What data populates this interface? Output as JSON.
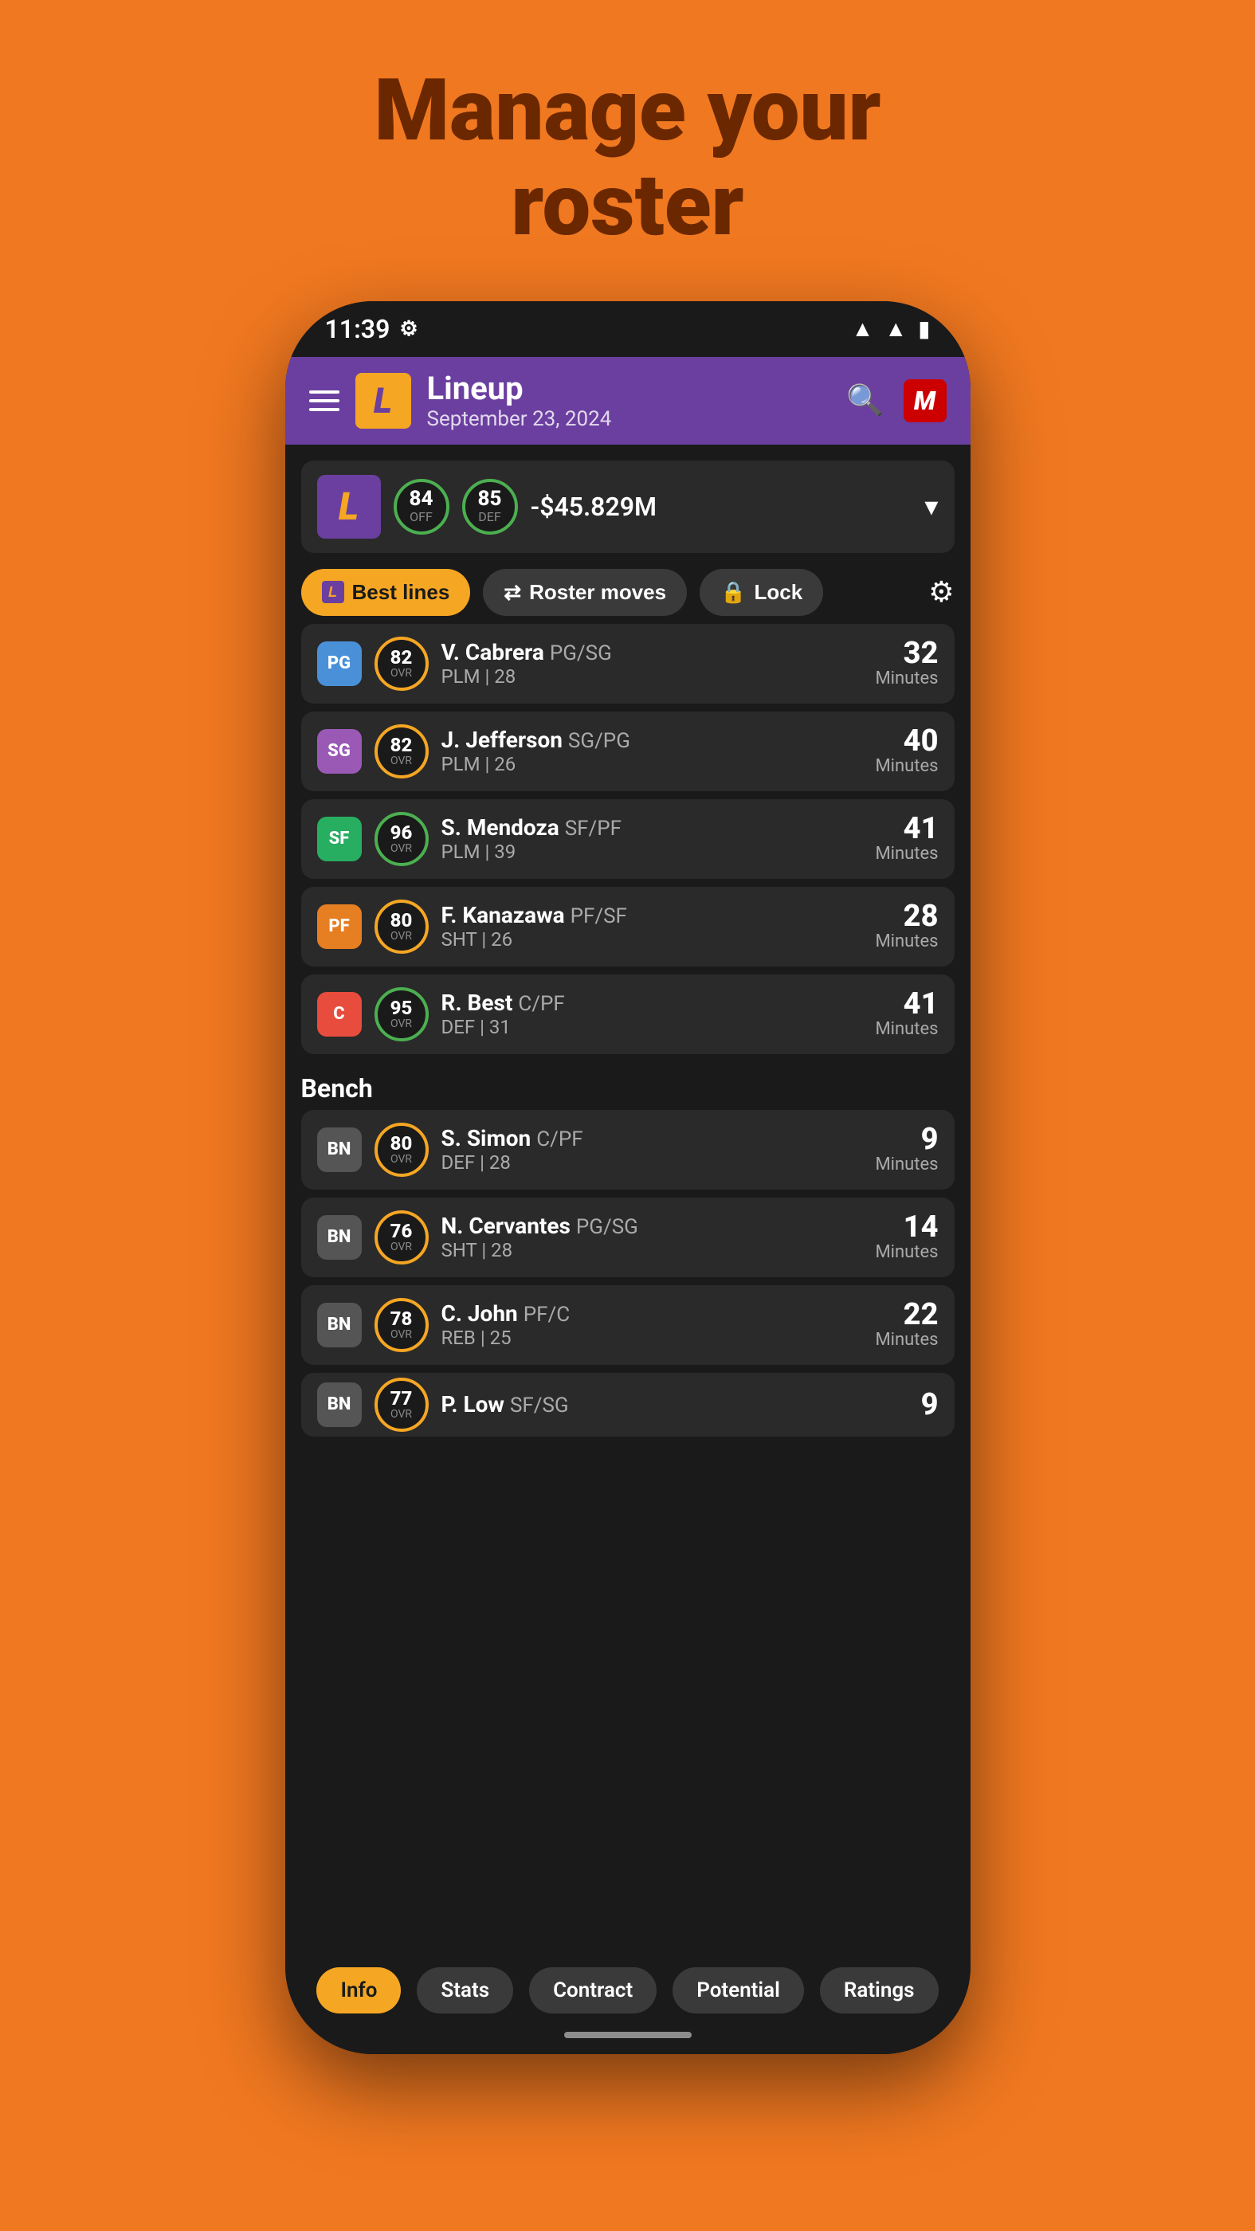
{
  "page": {
    "bg_title_line1": "Manage your",
    "bg_title_line2": "roster"
  },
  "status_bar": {
    "time": "11:39",
    "wifi": "▲",
    "signal": "▲",
    "battery": "🔋"
  },
  "header": {
    "title": "Lineup",
    "subtitle": "September 23, 2024",
    "team_initial": "L"
  },
  "team_summary": {
    "logo_initial": "L",
    "off_rating": "84",
    "off_label": "OFF",
    "def_rating": "85",
    "def_label": "DEF",
    "salary": "-$45.829M"
  },
  "action_buttons": {
    "best_lines": "Best lines",
    "roster_moves": "Roster moves",
    "lock": "Lock"
  },
  "starters": [
    {
      "position": "PG",
      "pos_class": "pos-pg",
      "rating": "82",
      "border_class": "yellow-border",
      "name": "V. Cabrera",
      "pos_detail": "PG/SG",
      "team_detail": "PLM | 28",
      "minutes": "32"
    },
    {
      "position": "SG",
      "pos_class": "pos-sg",
      "rating": "82",
      "border_class": "yellow-border",
      "name": "J. Jefferson",
      "pos_detail": "SG/PG",
      "team_detail": "PLM | 26",
      "minutes": "40"
    },
    {
      "position": "SF",
      "pos_class": "pos-sf",
      "rating": "96",
      "border_class": "",
      "name": "S. Mendoza",
      "pos_detail": "SF/PF",
      "team_detail": "PLM | 39",
      "minutes": "41"
    },
    {
      "position": "PF",
      "pos_class": "pos-pf",
      "rating": "80",
      "border_class": "yellow-border",
      "name": "F. Kanazawa",
      "pos_detail": "PF/SF",
      "team_detail": "SHT | 26",
      "minutes": "28"
    },
    {
      "position": "C",
      "pos_class": "pos-c",
      "rating": "95",
      "border_class": "",
      "name": "R. Best",
      "pos_detail": "C/PF",
      "team_detail": "DEF | 31",
      "minutes": "41"
    }
  ],
  "bench_label": "Bench",
  "bench": [
    {
      "position": "BN",
      "pos_class": "pos-bn",
      "rating": "80",
      "border_class": "yellow-border",
      "name": "S. Simon",
      "pos_detail": "C/PF",
      "team_detail": "DEF | 28",
      "minutes": "9"
    },
    {
      "position": "BN",
      "pos_class": "pos-bn",
      "rating": "76",
      "border_class": "yellow-border",
      "name": "N. Cervantes",
      "pos_detail": "PG/SG",
      "team_detail": "SHT | 28",
      "minutes": "14"
    },
    {
      "position": "BN",
      "pos_class": "pos-bn",
      "rating": "78",
      "border_class": "yellow-border",
      "name": "C. John",
      "pos_detail": "PF/C",
      "team_detail": "REB | 25",
      "minutes": "22"
    },
    {
      "position": "BN",
      "pos_class": "pos-bn",
      "rating": "77",
      "border_class": "yellow-border",
      "name": "P. Low",
      "pos_detail": "SF/SG",
      "team_detail": "",
      "minutes": "9"
    }
  ],
  "bottom_tabs": [
    {
      "label": "Info",
      "active": true
    },
    {
      "label": "Stats",
      "active": false
    },
    {
      "label": "Contract",
      "active": false
    },
    {
      "label": "Potential",
      "active": false
    },
    {
      "label": "Ratings",
      "active": false
    }
  ],
  "minutes_label": "Minutes"
}
